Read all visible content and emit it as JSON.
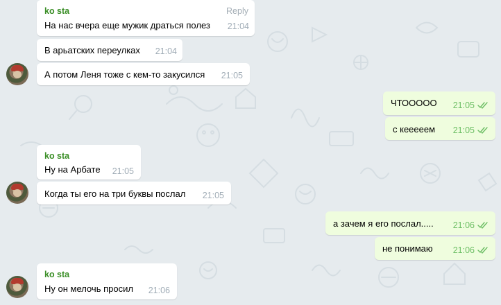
{
  "chat": {
    "sender_name": "ko sta",
    "reply_label": "Reply",
    "messages": [
      {
        "direction": "in",
        "text": "На нас вчера еще мужик драться полез",
        "time": "21:04"
      },
      {
        "direction": "in",
        "text": "В арьатских переулках",
        "time": "21:04"
      },
      {
        "direction": "in",
        "text": "А потом Леня тоже с кем-то закусился",
        "time": "21:05"
      },
      {
        "direction": "out",
        "text": "ЧТООООО",
        "time": "21:05"
      },
      {
        "direction": "out",
        "text": "с кееееем",
        "time": "21:05"
      },
      {
        "direction": "in",
        "text": "Ну на Арбате",
        "time": "21:05"
      },
      {
        "direction": "in",
        "text": "Когда ты его на три буквы послал",
        "time": "21:05"
      },
      {
        "direction": "out",
        "text": "а зачем я его послал.....",
        "time": "21:06"
      },
      {
        "direction": "out",
        "text": "не понимаю",
        "time": "21:06"
      },
      {
        "direction": "in",
        "text": "Ну он мелочь просил",
        "time": "21:06"
      }
    ]
  },
  "colors": {
    "background": "#e6ebee",
    "incoming_bubble": "#ffffff",
    "outgoing_bubble": "#effdde",
    "sender_name": "#3a8e26",
    "read_ticks": "#6cbe64"
  },
  "icons": {
    "read_status": "double-check-icon",
    "avatar": "user-avatar"
  }
}
